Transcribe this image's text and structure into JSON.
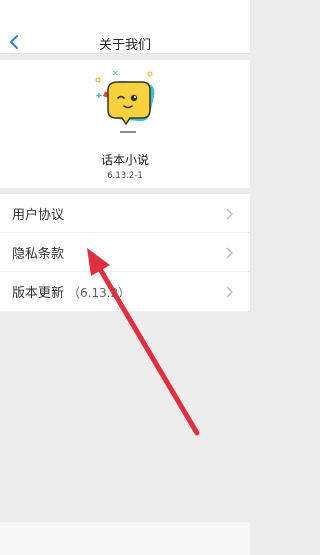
{
  "header": {
    "title": "关于我们"
  },
  "app": {
    "name": "话本小说",
    "version": "6.13.2-1"
  },
  "menu": {
    "items": [
      {
        "label": "用户协议"
      },
      {
        "label": "隐私条款"
      },
      {
        "label": "版本更新",
        "version_text": "（6.13.2）"
      }
    ]
  },
  "colors": {
    "back_icon": "#3a7bd5",
    "annotation_arrow": "#e0303f",
    "logo_yellow": "#f7d23c"
  }
}
